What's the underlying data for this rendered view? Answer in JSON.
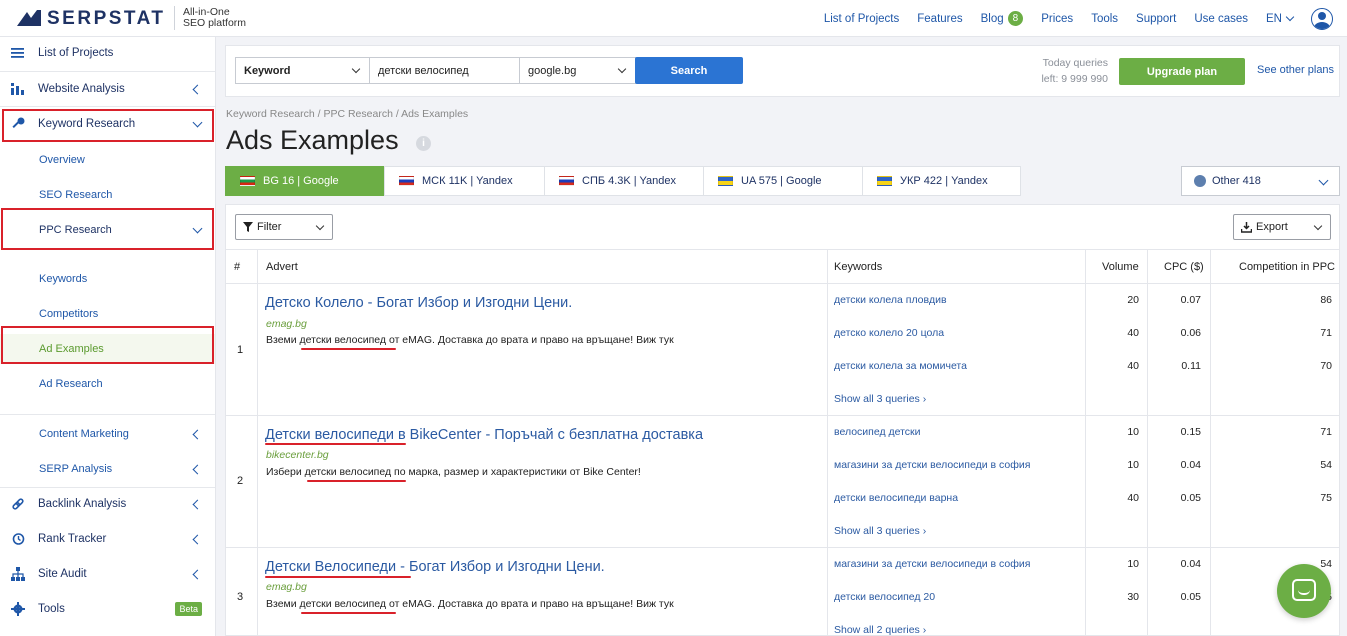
{
  "brand": {
    "name": "SERPSTAT",
    "tagline_line1": "All-in-One",
    "tagline_line2": "SEO platform"
  },
  "topnav": {
    "list_of_projects": "List of Projects",
    "features": "Features",
    "blog": "Blog",
    "blog_badge": "8",
    "prices": "Prices",
    "tools": "Tools",
    "support": "Support",
    "use_cases": "Use cases",
    "language": "EN"
  },
  "sidebar": {
    "list_of_projects": "List of Projects",
    "website_analysis": "Website Analysis",
    "keyword_research": "Keyword Research",
    "overview": "Overview",
    "seo_research": "SEO Research",
    "ppc_research": "PPC Research",
    "keywords": "Keywords",
    "competitors": "Competitors",
    "ad_examples": "Ad Examples",
    "ad_research": "Ad Research",
    "content_marketing": "Content Marketing",
    "serp_analysis": "SERP Analysis",
    "backlink_analysis": "Backlink Analysis",
    "rank_tracker": "Rank Tracker",
    "site_audit": "Site Audit",
    "tools": "Tools",
    "tools_badge": "Beta"
  },
  "search": {
    "type": "Keyword",
    "query": "детски велосипед",
    "engine": "google.bg",
    "button": "Search",
    "quota_line1": "Today queries",
    "quota_line2": "left: 9 999 990",
    "upgrade": "Upgrade plan",
    "other_plans": "See other plans"
  },
  "breadcrumb": "Keyword Research / PPC Research / Ads Examples",
  "page_title": "Ads Examples",
  "db_tabs": [
    {
      "label": "BG 16 | Google",
      "flag": "bg"
    },
    {
      "label": "МСК 11K | Yandex",
      "flag": "ru"
    },
    {
      "label": "СПБ 4.3K | Yandex",
      "flag": "ru"
    },
    {
      "label": "UA 575 | Google",
      "flag": "ua"
    },
    {
      "label": "УКР 422 | Yandex",
      "flag": "ua"
    }
  ],
  "other_db": "Other 418",
  "toolbar": {
    "filter": "Filter",
    "export": "Export"
  },
  "columns": {
    "num": "#",
    "advert": "Advert",
    "keywords": "Keywords",
    "volume": "Volume",
    "cpc": "CPC ($)",
    "competition": "Competition in PPC"
  },
  "ads": [
    {
      "num": "1",
      "title": "Детско Колело - Богат Избор и Изгодни Цени.",
      "url": "emag.bg",
      "desc": "Вземи детски велосипед от eMAG. Доставка до врата и право на връщане! Виж тук",
      "keywords": [
        {
          "kw": "детски колела пловдив",
          "volume": "20",
          "cpc": "0.07",
          "comp": "86"
        },
        {
          "kw": "детско колело 20 цола",
          "volume": "40",
          "cpc": "0.06",
          "comp": "71"
        },
        {
          "kw": "детски колела за момичета",
          "volume": "40",
          "cpc": "0.11",
          "comp": "70"
        }
      ],
      "show_all": "Show all 3 queries ›"
    },
    {
      "num": "2",
      "title": "Детски велосипеди в BikeCenter - Поръчай с безплатна доставка",
      "url": "bikecenter.bg",
      "desc": "Избери детски велосипед по марка, размер и характеристики от Bike Center!",
      "keywords": [
        {
          "kw": "велосипед детски",
          "volume": "10",
          "cpc": "0.15",
          "comp": "71"
        },
        {
          "kw": "магазини за детски велосипеди в софия",
          "volume": "10",
          "cpc": "0.04",
          "comp": "54"
        },
        {
          "kw": "детски велосипеди варна",
          "volume": "40",
          "cpc": "0.05",
          "comp": "75"
        }
      ],
      "show_all": "Show all 3 queries ›"
    },
    {
      "num": "3",
      "title": "Детски Велосипеди - Богат Избор и Изгодни Цени.",
      "url": "emag.bg",
      "desc": "Вземи детски велосипед от eMAG. Доставка до врата и право на връщане! Виж тук",
      "keywords": [
        {
          "kw": "магазини за детски велосипеди в софия",
          "volume": "10",
          "cpc": "0.04",
          "comp": "54"
        },
        {
          "kw": "детски велосипед 20",
          "volume": "30",
          "cpc": "0.05",
          "comp": "5"
        }
      ],
      "show_all": "Show all 2 queries ›"
    }
  ],
  "colors": {
    "brand_navy": "#1e3264",
    "link": "#1f57a8",
    "green": "#6cae45",
    "search_blue": "#2b74d3",
    "highlight_red": "#d9212a"
  }
}
